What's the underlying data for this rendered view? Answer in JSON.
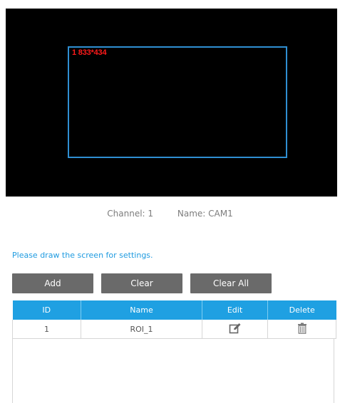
{
  "video": {
    "roi_label": "1 833*434",
    "roi_color": "#2f8fd2",
    "label_color": "#ff1a1a"
  },
  "meta": {
    "channel": "Channel: 1",
    "name": "Name: CAM1"
  },
  "hint": "Please draw the screen for settings.",
  "buttons": {
    "add": "Add",
    "clear": "Clear",
    "clear_all": "Clear All"
  },
  "table": {
    "headers": [
      "ID",
      "Name",
      "Edit",
      "Delete"
    ],
    "rows": [
      {
        "id": "1",
        "name": "ROI_1",
        "edit_icon": "edit-icon",
        "delete_icon": "trash-icon"
      }
    ]
  },
  "colors": {
    "accent": "#1fa0e2",
    "button_bg": "#6a6a6a"
  }
}
